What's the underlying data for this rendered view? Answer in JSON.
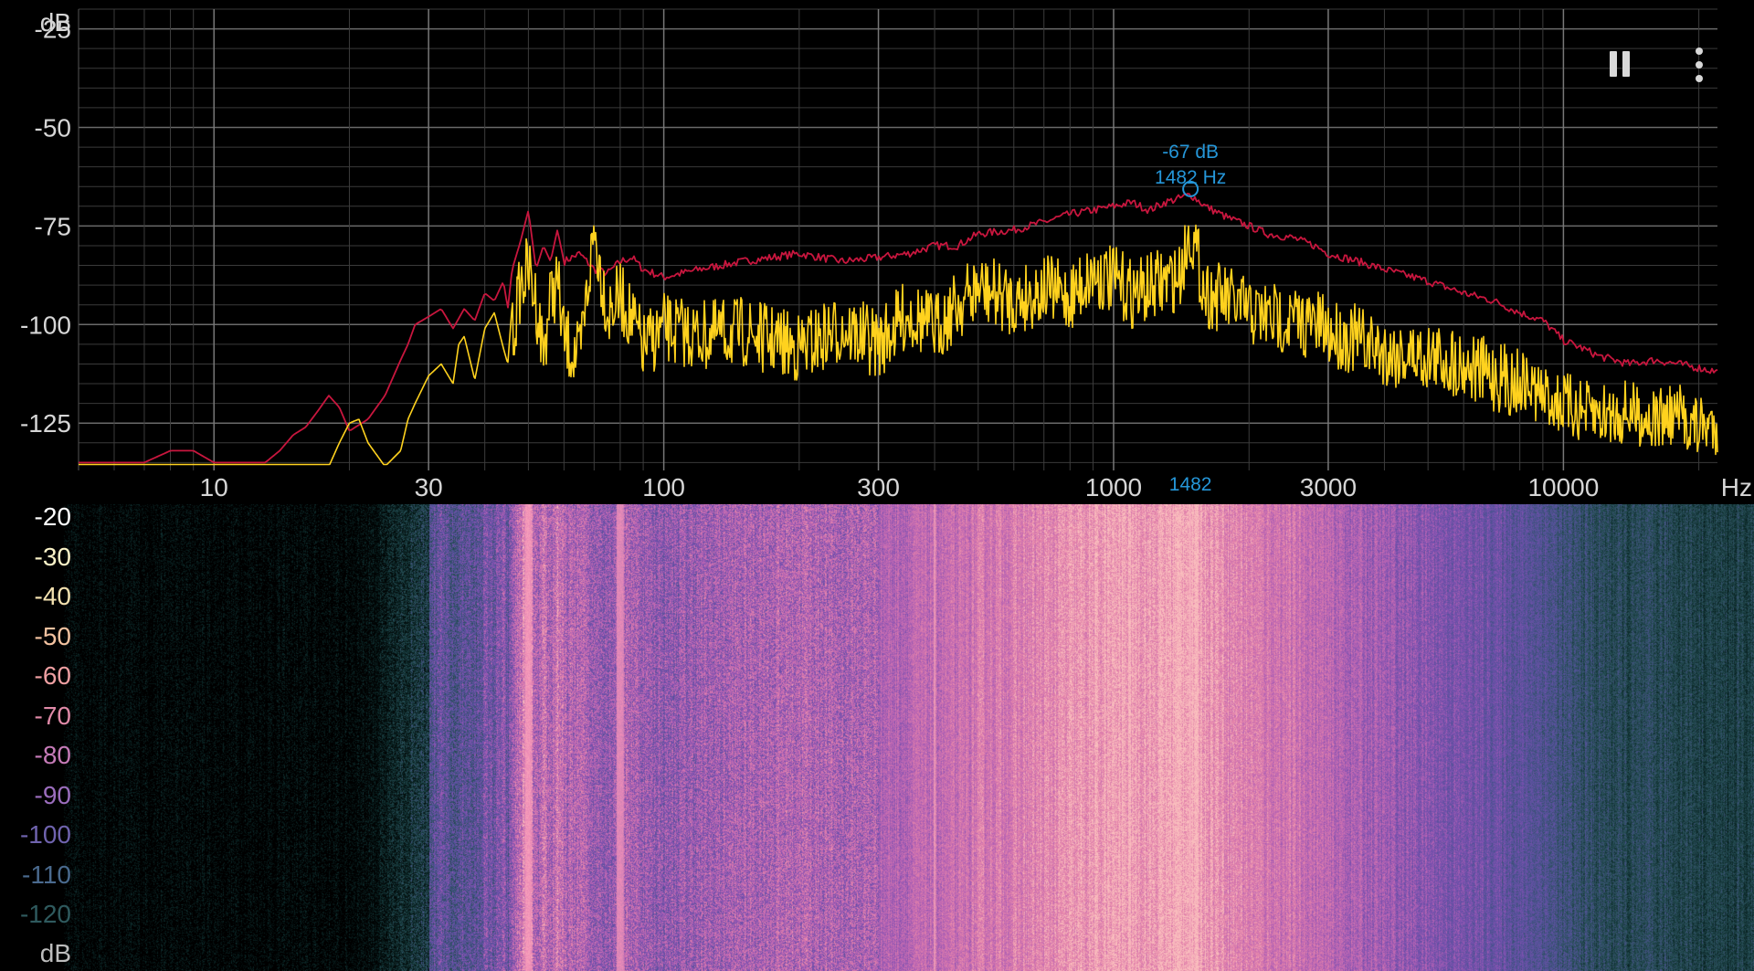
{
  "spectrum": {
    "y_unit": "dB",
    "x_unit": "Hz",
    "y_ticks": [
      "-25",
      "-50",
      "-75",
      "-100",
      "-125"
    ],
    "x_ticks": [
      "10",
      "30",
      "100",
      "300",
      "1000",
      "3000",
      "10000"
    ],
    "peak": {
      "db_text": "-67 dB",
      "freq_text": "1482 Hz",
      "axis_marker": "1482",
      "freq_hz": 1482,
      "db": -67
    },
    "colors": {
      "background": "#000000",
      "grid": "#555555",
      "current_trace": "#ffd21e",
      "peak_hold_trace": "#c8163e",
      "peak_marker": "#2596d8",
      "text": "#d6d6d6"
    }
  },
  "controls": {
    "pause_icon": "pause-icon",
    "menu_icon": "more-vert-icon"
  },
  "spectrogram": {
    "unit": "dB",
    "scale": [
      "-20",
      "-30",
      "-40",
      "-50",
      "-60",
      "-70",
      "-80",
      "-90",
      "-100",
      "-110",
      "-120"
    ],
    "scale_colors": [
      "#ffffff",
      "#fbf3c8",
      "#f4e2b0",
      "#f3c2a0",
      "#ee9fa2",
      "#e08aa8",
      "#c67bb8",
      "#9b6dbd",
      "#6f63ae",
      "#4a6a8e",
      "#2f5a5e"
    ],
    "bright_lines_hz": [
      50,
      80,
      400,
      1482
    ]
  },
  "chart_data": {
    "type": "line",
    "title": "",
    "xlabel": "Hz",
    "ylabel": "dB",
    "x_scale": "log",
    "xlim": [
      5,
      22000
    ],
    "ylim": [
      -137,
      -20
    ],
    "grid": true,
    "series": [
      {
        "color": "#c8163e",
        "x": [
          5,
          7,
          8,
          9,
          10,
          12,
          13,
          14,
          15,
          16,
          17,
          18,
          19,
          20,
          22,
          24,
          26,
          27,
          28,
          30,
          32,
          34,
          36,
          38,
          40,
          42,
          44,
          45,
          46,
          48,
          50,
          52,
          54,
          56,
          58,
          60,
          65,
          70,
          75,
          80,
          85,
          90,
          100,
          120,
          150,
          200,
          250,
          300,
          350,
          400,
          450,
          500,
          600,
          700,
          800,
          900,
          1000,
          1100,
          1200,
          1300,
          1400,
          1482,
          1600,
          1800,
          2000,
          2200,
          2500,
          2800,
          3000,
          3500,
          4000,
          5000,
          6000,
          7000,
          8000,
          9000,
          10000,
          11000,
          12000,
          14000,
          16000,
          18000,
          20000,
          22000
        ],
        "y": [
          -135,
          -135,
          -132,
          -132,
          -135,
          -135,
          -135,
          -132,
          -128,
          -126,
          -122,
          -118,
          -121,
          -127,
          -124,
          -118,
          -109,
          -105,
          -100,
          -98,
          -96,
          -101,
          -96,
          -99,
          -92,
          -94,
          -89,
          -96,
          -86,
          -79,
          -71,
          -86,
          -80,
          -84,
          -76,
          -84,
          -82,
          -86,
          -87,
          -84,
          -83,
          -86,
          -88,
          -86,
          -84,
          -82,
          -84,
          -83,
          -82,
          -80,
          -80,
          -77,
          -76,
          -74,
          -72,
          -71,
          -70,
          -69,
          -71,
          -69,
          -68,
          -67,
          -70,
          -73,
          -75,
          -77,
          -78,
          -80,
          -82,
          -84,
          -86,
          -89,
          -92,
          -94,
          -97,
          -99,
          -104,
          -106,
          -108,
          -110,
          -109,
          -110,
          -111,
          -112
        ]
      },
      {
        "color": "#ffd21e",
        "x": [
          5,
          18,
          19,
          20,
          21,
          22,
          24,
          26,
          27,
          28,
          30,
          32,
          34,
          35,
          36,
          38,
          40,
          42,
          44,
          45,
          46,
          48,
          50,
          52,
          54,
          56,
          58,
          60,
          65,
          70,
          75,
          80,
          85,
          90,
          100,
          120,
          150,
          200,
          250,
          300,
          350,
          400,
          450,
          500,
          600,
          700,
          800,
          900,
          1000,
          1100,
          1200,
          1300,
          1400,
          1482,
          1600,
          1800,
          2000,
          2200,
          2500,
          2800,
          3000,
          3500,
          4000,
          5000,
          6000,
          7000,
          8000,
          9000,
          10000,
          11000,
          12000,
          14000,
          16000,
          18000,
          20000,
          22000
        ],
        "y": [
          -136,
          -136,
          -130,
          -125,
          -124,
          -130,
          -136,
          -132,
          -124,
          -120,
          -113,
          -110,
          -115,
          -105,
          -103,
          -114,
          -101,
          -97,
          -106,
          -110,
          -95,
          -81,
          -77,
          -85,
          -98,
          -84,
          -80,
          -95,
          -100,
          -67,
          -88,
          -84,
          -90,
          -97,
          -92,
          -94,
          -93,
          -97,
          -92,
          -96,
          -88,
          -92,
          -86,
          -82,
          -85,
          -82,
          -84,
          -78,
          -80,
          -83,
          -82,
          -80,
          -79,
          -67,
          -83,
          -85,
          -88,
          -89,
          -90,
          -91,
          -93,
          -95,
          -98,
          -99,
          -101,
          -104,
          -106,
          -110,
          -112,
          -114,
          -115,
          -114,
          -116,
          -115,
          -118,
          -117
        ]
      }
    ]
  }
}
